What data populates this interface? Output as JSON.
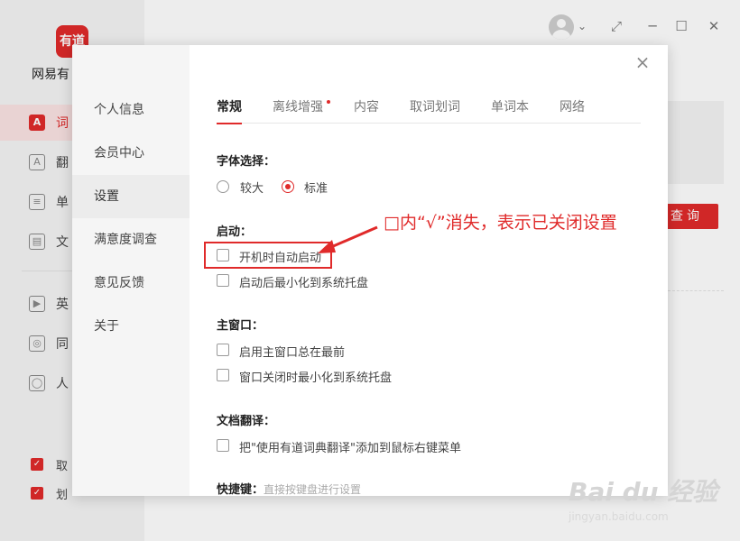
{
  "app": {
    "logo_text": "有道",
    "name": "网易有",
    "nav": [
      {
        "icon": "A",
        "label": "词"
      },
      {
        "icon": "A",
        "label": "翻"
      },
      {
        "icon": "≡",
        "label": "单"
      },
      {
        "icon": "▤",
        "label": "文"
      },
      {
        "icon": "▶",
        "label": "英"
      },
      {
        "icon": "◎",
        "label": "同"
      },
      {
        "icon": "◯",
        "label": "人"
      }
    ],
    "side_checks": [
      {
        "label": "取"
      },
      {
        "label": "划"
      }
    ],
    "query_button": "查询",
    "window_controls": {
      "minimize": "─",
      "maximize": "☐",
      "close": "✕",
      "restore": "⤢",
      "avatar_caret": "⌄"
    }
  },
  "dialog": {
    "close_label": "×",
    "side_items": [
      "个人信息",
      "会员中心",
      "设置",
      "满意度调查",
      "意见反馈",
      "关于"
    ],
    "active_side": "设置",
    "tabs": [
      "常规",
      "离线增强",
      "内容",
      "取词划词",
      "单词本",
      "网络"
    ],
    "active_tab": "常规",
    "font": {
      "title": "字体选择：",
      "options": [
        "较大",
        "标准"
      ],
      "selected": "标准"
    },
    "startup": {
      "title": "启动：",
      "options": [
        {
          "label": "开机时自动启动",
          "checked": false
        },
        {
          "label": "启动后最小化到系统托盘",
          "checked": false
        }
      ]
    },
    "main_window": {
      "title": "主窗口：",
      "options": [
        {
          "label": "启用主窗口总在最前",
          "checked": false
        },
        {
          "label": "窗口关闭时最小化到系统托盘",
          "checked": false
        }
      ]
    },
    "doc_translate": {
      "title": "文档翻译：",
      "options": [
        {
          "label": "把\"使用有道词典翻译\"添加到鼠标右键菜单",
          "checked": false
        }
      ]
    },
    "hotkey": {
      "title": "快捷键：",
      "hint": "直接按键盘进行设置"
    }
  },
  "annotation": {
    "text": "□内“√”消失，表示已关闭设置",
    "color": "#e02a2a"
  },
  "watermark": {
    "text": "Bai du 经验",
    "sub": "jingyan.baidu.com"
  },
  "colors": {
    "accent": "#e02a2a"
  }
}
